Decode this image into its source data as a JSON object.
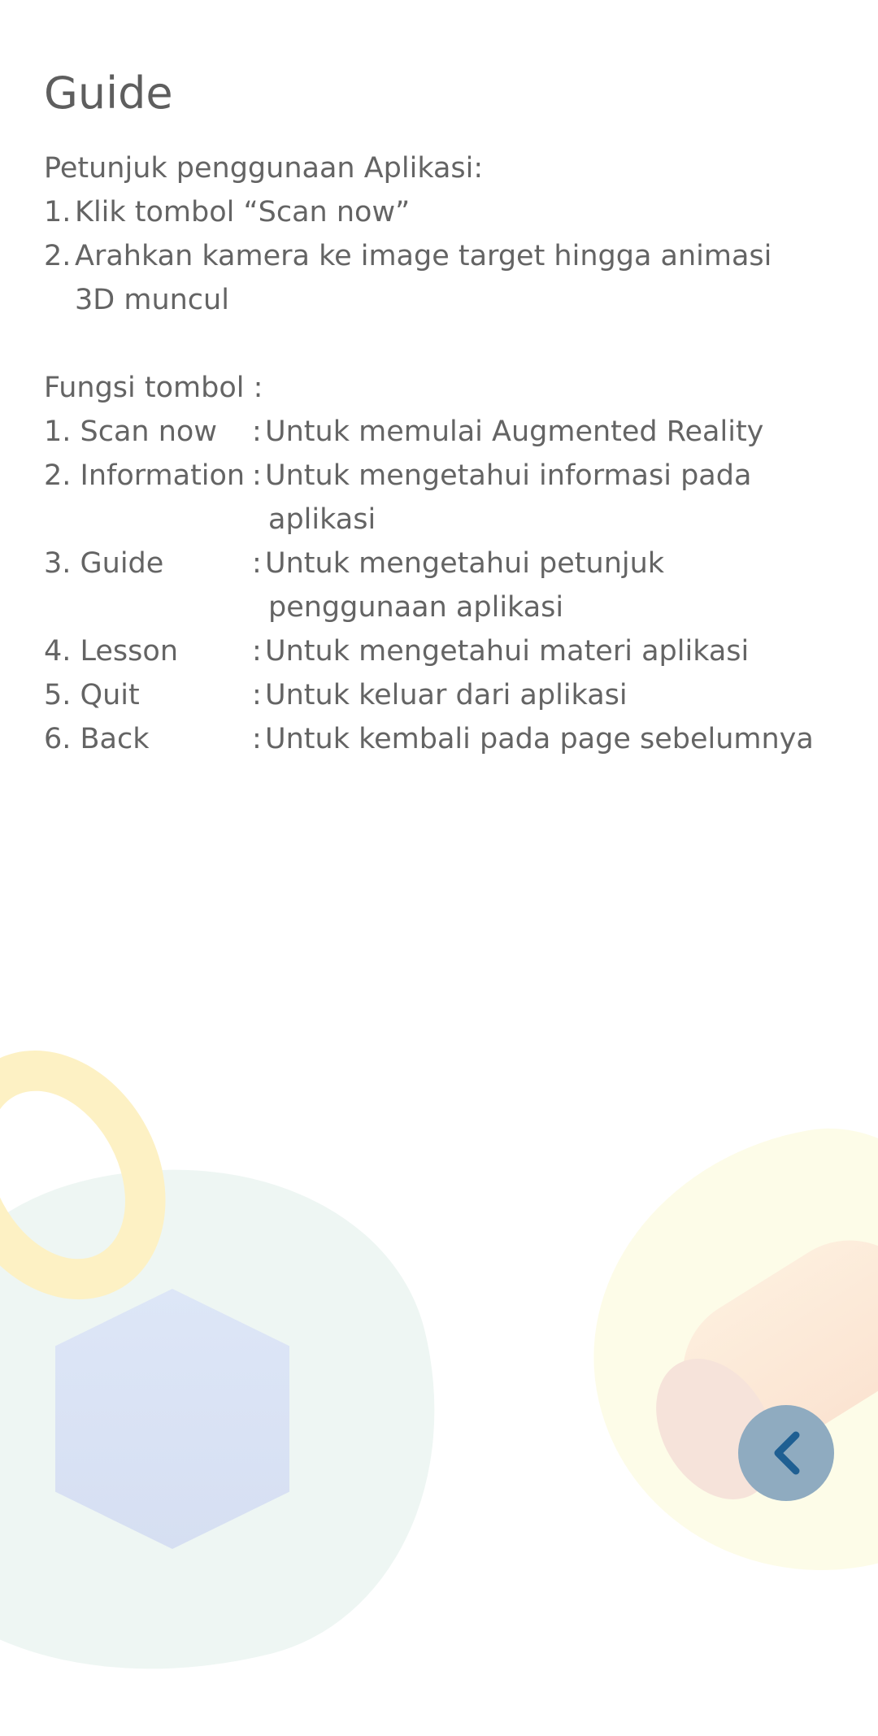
{
  "page": {
    "title": "Guide"
  },
  "instructions": {
    "heading": "Petunjuk penggunaan Aplikasi:",
    "steps": [
      {
        "number": "1.",
        "lines": [
          "Klik tombol “Scan now”"
        ]
      },
      {
        "number": "2.",
        "lines": [
          "Arahkan kamera ke image target hingga animasi",
          "3D muncul"
        ]
      }
    ]
  },
  "functions": {
    "heading": "Fungsi tombol :",
    "items": [
      {
        "name": "1.  Scan now",
        "lines": [
          "Untuk memulai Augmented Reality"
        ]
      },
      {
        "name": "2. Information",
        "lines": [
          "Untuk mengetahui informasi pada",
          "aplikasi"
        ]
      },
      {
        "name": "3. Guide",
        "lines": [
          "Untuk mengetahui petunjuk",
          "penggunaan aplikasi"
        ]
      },
      {
        "name": "4. Lesson",
        "lines": [
          "Untuk mengetahui materi aplikasi"
        ]
      },
      {
        "name": "5. Quit",
        "lines": [
          "Untuk keluar dari aplikasi"
        ]
      },
      {
        "name": "6. Back",
        "lines": [
          "Untuk kembali pada page sebelumnya"
        ]
      }
    ],
    "separator": ":"
  },
  "back_button": {
    "icon": "chevron-left-icon",
    "color": "#8fabc0",
    "icon_color": "#1f5f92"
  }
}
